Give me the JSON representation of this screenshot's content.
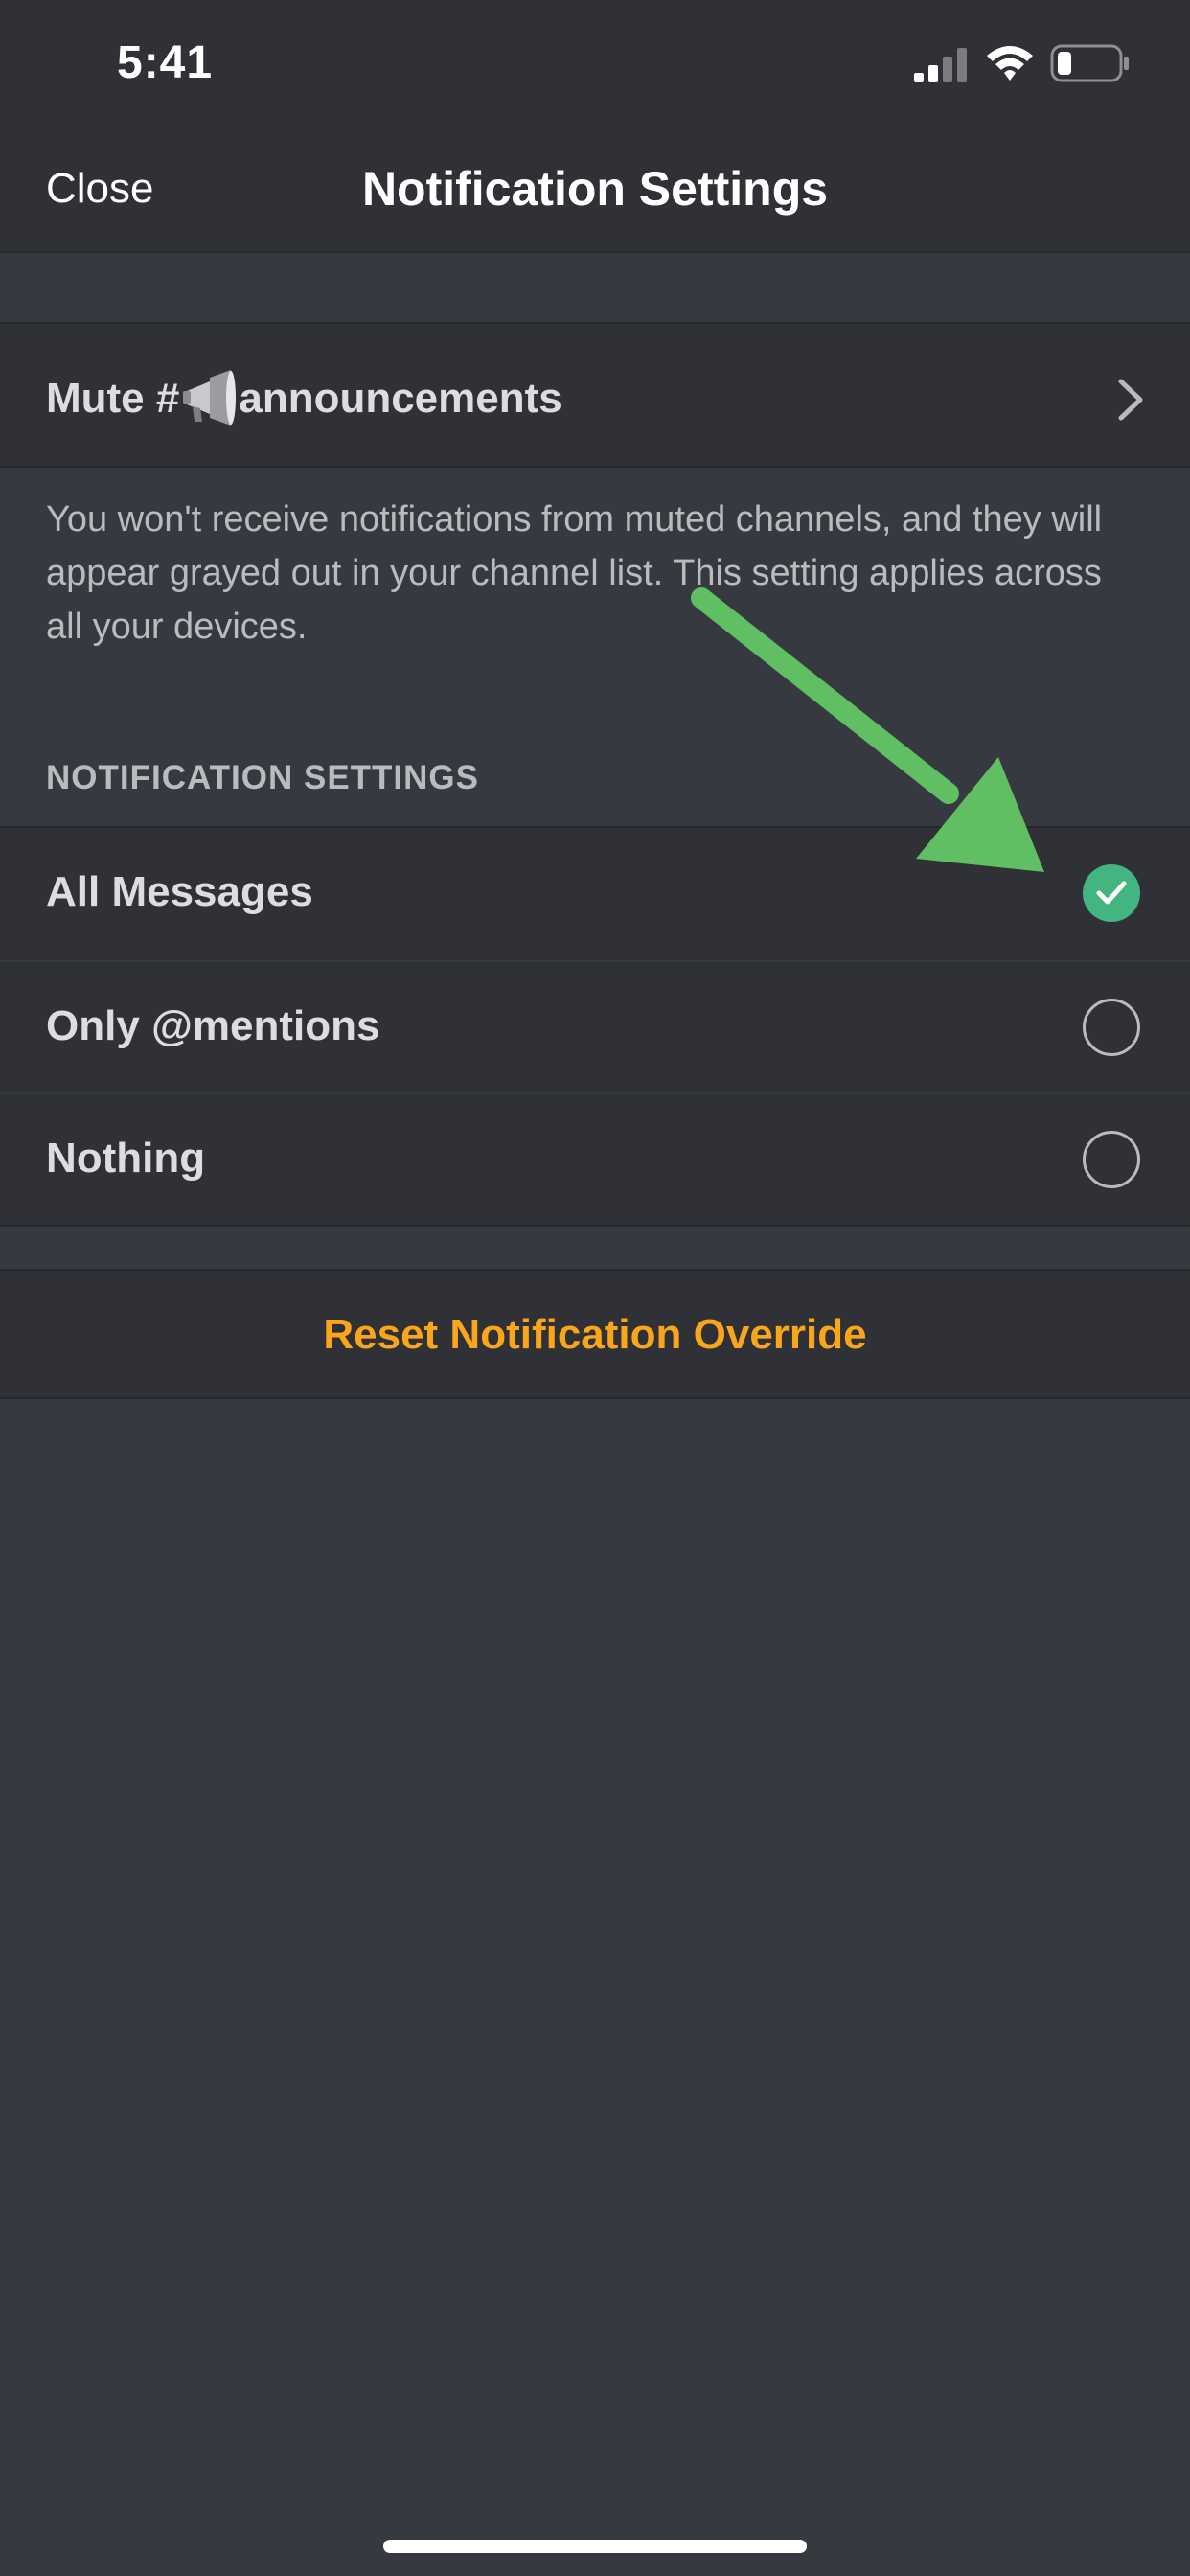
{
  "status_bar": {
    "time": "5:41",
    "signal_icon": "cellular-signal-icon",
    "wifi_icon": "wifi-icon",
    "battery_icon": "battery-low-icon"
  },
  "nav": {
    "close_label": "Close",
    "title": "Notification Settings"
  },
  "mute": {
    "label_prefix": "Mute #",
    "channel_icon": "megaphone-icon",
    "channel_name": "announcements",
    "chevron_icon": "chevron-right-icon",
    "description": "You won't receive notifications from muted channels, and they will appear grayed out in your channel list. This setting applies across all your devices."
  },
  "notification_settings": {
    "header": "NOTIFICATION SETTINGS",
    "selected": "All Messages",
    "options": [
      {
        "label": "All Messages",
        "checked": true
      },
      {
        "label": "Only @mentions",
        "checked": false
      },
      {
        "label": "Nothing",
        "checked": false
      }
    ]
  },
  "reset": {
    "label": "Reset Notification Override"
  },
  "colors": {
    "background": "#36393f",
    "surface": "#2f3136",
    "accent_green": "#43b581",
    "reset_orange": "#faa61a",
    "annotation_arrow": "#5fbf62"
  }
}
